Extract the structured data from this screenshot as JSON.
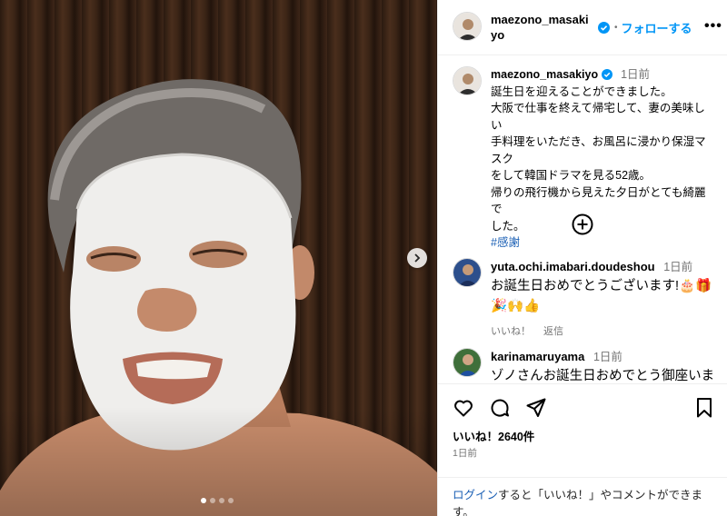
{
  "user": {
    "username": "maezono_masakiyo",
    "header_username_line1": "maezono_masaki",
    "header_username_line2": "yo",
    "follow_separator": "•",
    "follow_label": "フォローする"
  },
  "caption": {
    "time": "1日前",
    "lines": [
      "誕生日を迎えることができました。",
      "大阪で仕事を終えて帰宅して、妻の美味しい",
      "手料理をいただき、お風呂に浸かり保湿マスク",
      "をして韓国ドラマを見る52歳。",
      "帰りの飛行機から見えた夕日がとても綺麗で",
      "した。"
    ],
    "hashtag": "#感謝"
  },
  "comments": [
    {
      "username": "yuta.ochi.imabari.doudeshou",
      "time": "1日前",
      "text_line1": "お誕生日おめでとうございます!🎂🎁",
      "text_line2": "🎉🙌👍",
      "like_label": "いいね！",
      "reply_label": "返信"
    },
    {
      "username": "karinamaruyama",
      "time": "1日前",
      "text_line1": "ゾノさんお誕生日おめでとう御座いま"
    }
  ],
  "stats": {
    "likes": "いいね！2640件",
    "date": "1日前"
  },
  "login_prompt": {
    "link": "ログイン",
    "rest_line1": "すると「いいね！」やコメントができま",
    "rest_line2": "す。"
  },
  "colors": {
    "accent": "#0095f6",
    "link": "#1a5fb4",
    "muted": "#737373"
  },
  "icons": [
    "chevron-right-icon",
    "verified-badge-icon",
    "more-options-icon",
    "plus-circle-icon",
    "heart-icon",
    "comment-icon",
    "share-icon",
    "bookmark-icon"
  ]
}
